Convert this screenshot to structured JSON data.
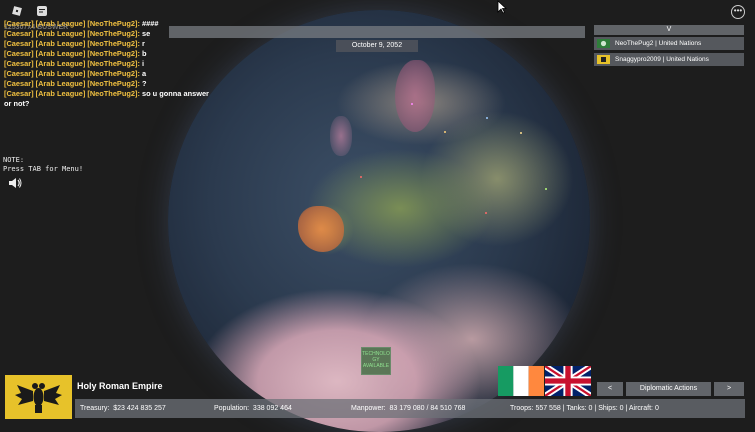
{
  "chat": {
    "overlay_text": "125307x4 BUSWER",
    "messages": [
      {
        "prefix": "[Caesar] [Arab League] [NeoThePug2]:",
        "text": "####"
      },
      {
        "prefix": "[Caesar] [Arab League] [NeoThePug2]:",
        "text": "se"
      },
      {
        "prefix": "[Caesar] [Arab League] [NeoThePug2]:",
        "text": "r"
      },
      {
        "prefix": "[Caesar] [Arab League] [NeoThePug2]:",
        "text": "b"
      },
      {
        "prefix": "[Caesar] [Arab League] [NeoThePug2]:",
        "text": "i"
      },
      {
        "prefix": "[Caesar] [Arab League] [NeoThePug2]:",
        "text": "a"
      },
      {
        "prefix": "[Caesar] [Arab League] [NeoThePug2]:",
        "text": "?"
      },
      {
        "prefix": "[Caesar] [Arab League] [NeoThePug2]:",
        "text": "so u gonna answer"
      }
    ],
    "continuation": "or not?"
  },
  "note": {
    "line1": "NOTE:",
    "line2": "Press TAB for Menu!"
  },
  "date": "October 9, 2052",
  "right_panel": {
    "toggle_label": "V",
    "players": [
      {
        "name": "NeoThePug2",
        "sep": "|",
        "nation": "United Nations"
      },
      {
        "name": "Snaggypro2009",
        "sep": "|",
        "nation": "United Nations"
      }
    ]
  },
  "tech_notice": {
    "line1": "TECHNOLO",
    "line2": "GY",
    "line3": "AVAILABLE"
  },
  "nation": {
    "name": "Holy Roman Empire"
  },
  "stats": {
    "treasury_label": "Treasury:",
    "treasury_value": "$23 424 835 257",
    "population_label": "Population:",
    "population_value": "338 092 464",
    "manpower_label": "Manpower:",
    "manpower_value": "83 179 080  /  84 510 768",
    "troops_label": "Troops:",
    "troops_value": "557 558",
    "tanks_label": "Tanks:",
    "tanks_value": "0",
    "ships_label": "Ships:",
    "ships_value": "0",
    "aircraft_label": "Aircraft:",
    "aircraft_value": "0",
    "sep": "|"
  },
  "buttons": {
    "prev": "<",
    "diplomatic": "Diplomatic Actions",
    "next": ">"
  },
  "menu": {
    "dots": "•••"
  },
  "colors": {
    "chat_prefix": "#f0c040",
    "ireland_green": "#169b62",
    "ireland_orange": "#ff883e",
    "uk_blue": "#012169",
    "uk_red": "#c8102e",
    "emblem_gold": "#e7c22a"
  },
  "icons": [
    "roblox-logo-icon",
    "chat-icon",
    "speaker-icon",
    "mouse-cursor-icon",
    "menu-dots-icon",
    "eagle-emblem-icon"
  ]
}
